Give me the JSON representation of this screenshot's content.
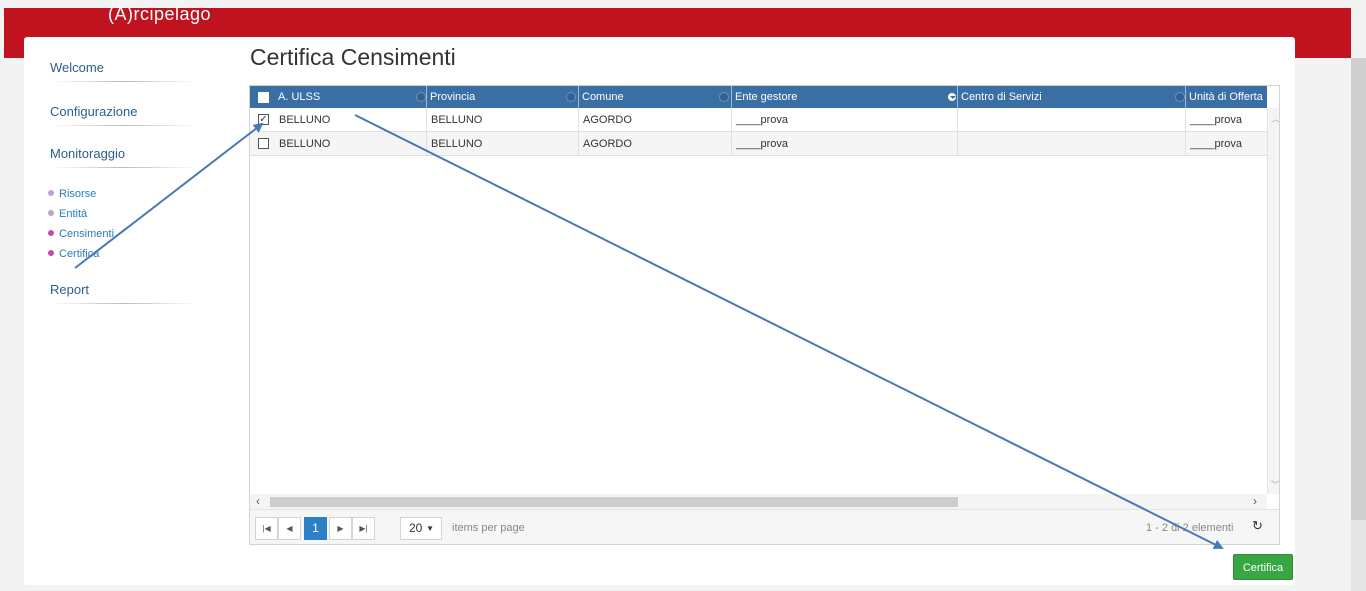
{
  "header": {
    "logo": "(A)rcipelago"
  },
  "sidebar": {
    "items": [
      {
        "label": "Welcome"
      },
      {
        "label": "Configurazione"
      },
      {
        "label": "Monitoraggio"
      },
      {
        "label": "Report"
      }
    ],
    "sub_items": [
      {
        "label": "Risorse",
        "dot": "#b9a4d0"
      },
      {
        "label": "Entità",
        "dot": "#b9a4d0"
      },
      {
        "label": "Censimenti",
        "dot": "#c04fa7"
      },
      {
        "label": "Certifica",
        "dot": "#c04fa7"
      }
    ]
  },
  "page": {
    "title": "Certifica Censimenti"
  },
  "grid": {
    "columns": [
      "A. ULSS",
      "Provincia",
      "Comune",
      "Ente gestore",
      "Centro di Servizi",
      "Unità di Offerta"
    ],
    "rows": [
      {
        "checked": true,
        "cells": [
          "BELLUNO",
          "BELLUNO",
          "AGORDO",
          "____prova",
          "",
          "____prova"
        ]
      },
      {
        "checked": false,
        "cells": [
          "BELLUNO",
          "BELLUNO",
          "AGORDO",
          "____prova",
          "",
          "____prova"
        ]
      }
    ],
    "header_color": "#3a6fa5"
  },
  "pager": {
    "current_page": "1",
    "page_size": "20",
    "items_per_page_label": "items per page",
    "info": "1 - 2 di 2 elementi"
  },
  "actions": {
    "certifica_label": "Certifica",
    "accent": "#38a743"
  },
  "annotation": {
    "arrow_color": "#4a78b5"
  }
}
